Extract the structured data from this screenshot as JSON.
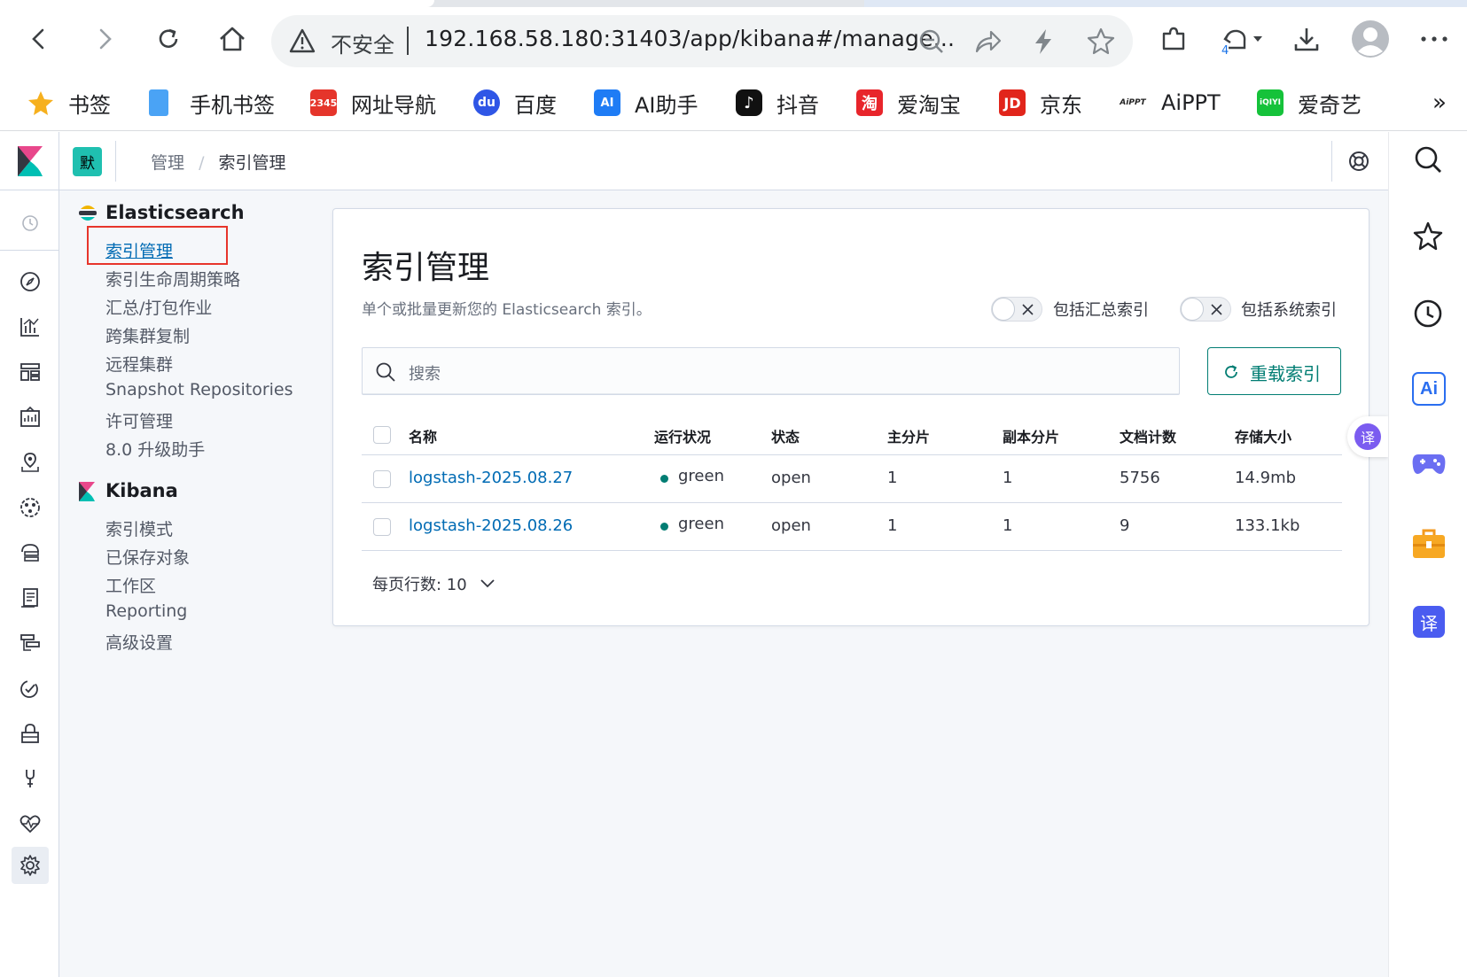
{
  "browser": {
    "insecure_label": "不安全",
    "url": "192.168.58.180:31403/app/kibana#/manage...",
    "history_badge": "4",
    "bookmarks": [
      {
        "label": "书签",
        "icon": "star-icon",
        "color": "#f6b01e"
      },
      {
        "label": "手机书签",
        "icon": "phone-bookmark-icon",
        "color": "#4aa3f5"
      },
      {
        "label": "网址导航",
        "icon": "nav-icon",
        "color": "#e5352b",
        "glyph": "2345"
      },
      {
        "label": "百度",
        "icon": "baidu-icon",
        "color": "#2f56e6",
        "glyph": "du"
      },
      {
        "label": "AI助手",
        "icon": "ai-assistant-icon",
        "color": "#1e7cf5",
        "glyph": "AI"
      },
      {
        "label": "抖音",
        "icon": "douyin-icon",
        "color": "#111111",
        "glyph": "♪"
      },
      {
        "label": "爱淘宝",
        "icon": "taobao-icon",
        "color": "#e8252b",
        "glyph": "淘"
      },
      {
        "label": "京东",
        "icon": "jd-icon",
        "color": "#e1251b",
        "glyph": "JD"
      },
      {
        "label": "AiPPT",
        "icon": "aippt-icon",
        "color": "#222222",
        "glyph": "AiPPT"
      },
      {
        "label": "爱奇艺",
        "icon": "iqiyi-icon",
        "color": "#15c23a",
        "glyph": "iQIYI"
      }
    ],
    "more_label": "»"
  },
  "kibana": {
    "space_avatar": "默",
    "space_color": "#1fc0b0",
    "breadcrumb": [
      "管理",
      "索引管理"
    ],
    "sidebar": {
      "sections": [
        {
          "title": "Elasticsearch",
          "items": [
            "索引管理",
            "索引生命周期策略",
            "汇总/打包作业",
            "跨集群复制",
            "远程集群",
            "Snapshot Repositories",
            "许可管理",
            "8.0 升级助手"
          ]
        },
        {
          "title": "Kibana",
          "items": [
            "索引模式",
            "已保存对象",
            "工作区",
            "Reporting",
            "高级设置"
          ]
        }
      ]
    },
    "page": {
      "title": "索引管理",
      "subtitle": "单个或批量更新您的 Elasticsearch 索引。",
      "toggle_rollup": "包括汇总索引",
      "toggle_system": "包括系统索引",
      "search_placeholder": "搜索",
      "reload_button": "重载索引",
      "columns": [
        "名称",
        "运行状况",
        "状态",
        "主分片",
        "副本分片",
        "文档计数",
        "存储大小"
      ],
      "rows": [
        {
          "name": "logstash-2025.08.27",
          "health": "green",
          "status": "open",
          "primary": "1",
          "replicas": "1",
          "docs": "5756",
          "size": "14.9mb"
        },
        {
          "name": "logstash-2025.08.26",
          "health": "green",
          "status": "open",
          "primary": "1",
          "replicas": "1",
          "docs": "9",
          "size": "133.1kb"
        }
      ],
      "rows_per_page": "每页行数: 10"
    }
  },
  "colors": {
    "link": "#006bb4",
    "accent": "#017d73",
    "health_green": "#017d73",
    "highlight_box": "#e7352b"
  },
  "right_panel": {
    "translate_badge": "译"
  }
}
